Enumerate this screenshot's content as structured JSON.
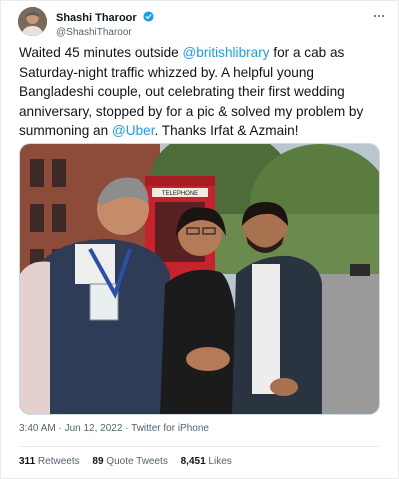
{
  "author": {
    "display_name": "Shashi Tharoor",
    "handle": "@ShashiTharoor",
    "verified_color": "#1d9bf0"
  },
  "more_icon": "more-horizontal-icon",
  "tweet": {
    "part1": "Waited 45 minutes outside ",
    "mention1": "@britishlibrary",
    "part2": " for a cab as Saturday-night traffic whizzed by. A helpful young Bangladeshi couple, out celebrating their first wedding anniversary, stopped by for a pic & solved my problem by summoning an ",
    "mention2": "@Uber",
    "part3": ". Thanks Irfat & Azmain!"
  },
  "photo_sign": "TELEPHONE",
  "meta": {
    "time": "3:40 AM",
    "sep1": " · ",
    "date": "Jun 12, 2022",
    "sep2": " · ",
    "source": "Twitter for iPhone"
  },
  "stats": {
    "retweets_count": "311",
    "retweets_label": "Retweets",
    "quotes_count": "89",
    "quotes_label": "Quote Tweets",
    "likes_count": "8,451",
    "likes_label": "Likes"
  },
  "colors": {
    "link": "#1d9bf0",
    "text": "#0f1419",
    "secondary": "#536471"
  }
}
